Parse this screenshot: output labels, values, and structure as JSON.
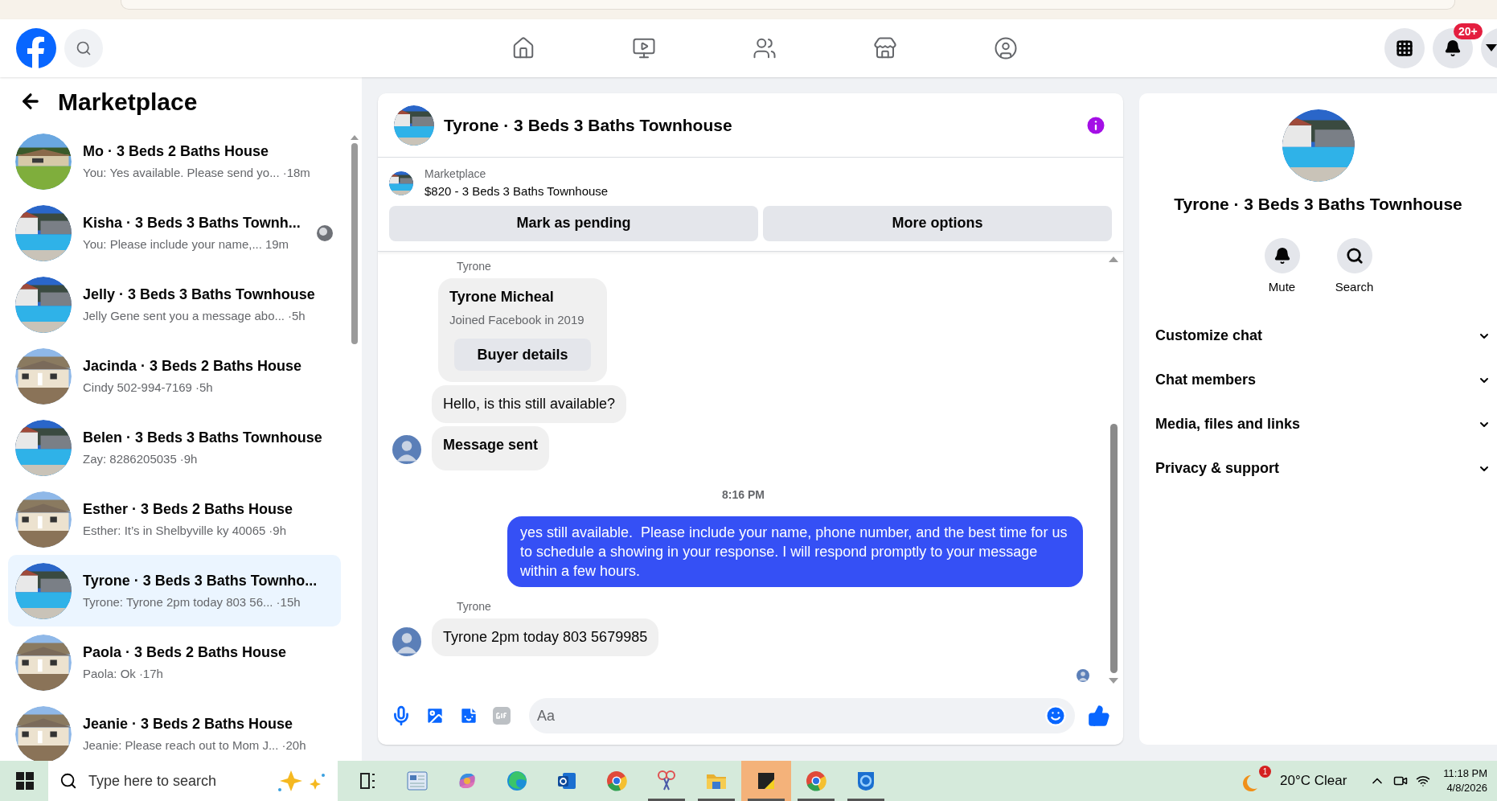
{
  "header": {
    "notification_badge": "20+"
  },
  "sidebar": {
    "title": "Marketplace",
    "conversations": [
      {
        "name": "Mo · 3 Beds 2 Baths House",
        "preview": "You: Yes available. Please send yo...",
        "time": "·18m",
        "selected": false,
        "read_receipt": false
      },
      {
        "name": "Kisha · 3 Beds 3 Baths Townh...",
        "preview": "You: Please include your name,...",
        "time": "19m",
        "selected": false,
        "read_receipt": true
      },
      {
        "name": "Jelly · 3 Beds 3 Baths Townhouse",
        "preview": "Jelly Gene sent you a message abo...",
        "time": "·5h",
        "selected": false,
        "read_receipt": false
      },
      {
        "name": "Jacinda · 3 Beds 2 Baths House",
        "preview": "Cindy 502-994-7169",
        "time": "·5h",
        "selected": false,
        "read_receipt": false
      },
      {
        "name": "Belen · 3 Beds 3 Baths Townhouse",
        "preview": "Zay: 8286205035",
        "time": "·9h",
        "selected": false,
        "read_receipt": false
      },
      {
        "name": "Esther · 3 Beds 2 Baths House",
        "preview": "Esther: It’s in Shelbyville ky 40065",
        "time": "·9h",
        "selected": false,
        "read_receipt": false
      },
      {
        "name": "Tyrone · 3 Beds 3 Baths Townho...",
        "preview": "Tyrone: Tyrone 2pm today 803 56...",
        "time": "·15h",
        "selected": true,
        "read_receipt": false
      },
      {
        "name": "Paola · 3 Beds 2 Baths House",
        "preview": "Paola: Ok",
        "time": "·17h",
        "selected": false,
        "read_receipt": false
      },
      {
        "name": "Jeanie · 3 Beds 2 Baths House",
        "preview": "Jeanie: Please reach out to Mom J...",
        "time": "·20h",
        "selected": false,
        "read_receipt": false
      }
    ]
  },
  "chat": {
    "title": "Tyrone · 3 Beds 3 Baths Townhouse",
    "listing": {
      "label": "Marketplace",
      "title": "$820 - 3 Beds 3 Baths Townhouse"
    },
    "actions": [
      "Mark as pending",
      "More options"
    ],
    "messages": [
      {
        "kind": "sender",
        "text": "Tyrone"
      },
      {
        "kind": "profile_card",
        "name": "Tyrone Micheal",
        "detail": "Joined Facebook in 2019",
        "button": "Buyer details"
      },
      {
        "kind": "incoming",
        "text": "Hello, is this still available?",
        "avatar": false,
        "bold": false
      },
      {
        "kind": "incoming",
        "text": "Message sent",
        "avatar": true,
        "bold": true
      },
      {
        "kind": "timestamp",
        "text": "8:16 PM"
      },
      {
        "kind": "outgoing",
        "text": "yes still available.  Please include your name, phone number, and the best time for us to schedule a showing in your response. I will respond promptly to your message within a few hours."
      },
      {
        "kind": "sender",
        "text": "Tyrone"
      },
      {
        "kind": "incoming",
        "text": "Tyrone 2pm today 803 5679985",
        "avatar": true,
        "bold": false
      }
    ],
    "composer": {
      "placeholder": "Aa"
    }
  },
  "details": {
    "title": "Tyrone · 3 Beds 3 Baths Townhouse",
    "actions": [
      {
        "kind": "mute",
        "label": "Mute"
      },
      {
        "kind": "search",
        "label": "Search"
      }
    ],
    "sections": [
      "Customize chat",
      "Chat members",
      "Media, files and links",
      "Privacy & support"
    ]
  },
  "taskbar": {
    "search_placeholder": "Type here to search",
    "apps": [
      {
        "kind": "task_view",
        "running": false,
        "selected": false
      },
      {
        "kind": "widgets",
        "running": false,
        "selected": false
      },
      {
        "kind": "copilot",
        "running": false,
        "selected": false
      },
      {
        "kind": "edge",
        "running": false,
        "selected": false
      },
      {
        "kind": "outlook",
        "running": false,
        "selected": false
      },
      {
        "kind": "chrome",
        "running": false,
        "selected": false
      },
      {
        "kind": "snip",
        "running": true,
        "selected": false
      },
      {
        "kind": "folder",
        "running": true,
        "selected": false
      },
      {
        "kind": "notes",
        "running": true,
        "selected": true
      },
      {
        "kind": "chrome",
        "running": true,
        "selected": false
      },
      {
        "kind": "blue_app",
        "running": true,
        "selected": false
      }
    ],
    "weather_badge": "1",
    "weather": "20°C Clear",
    "time": "11:18 PM",
    "date": "4/8/2026"
  }
}
